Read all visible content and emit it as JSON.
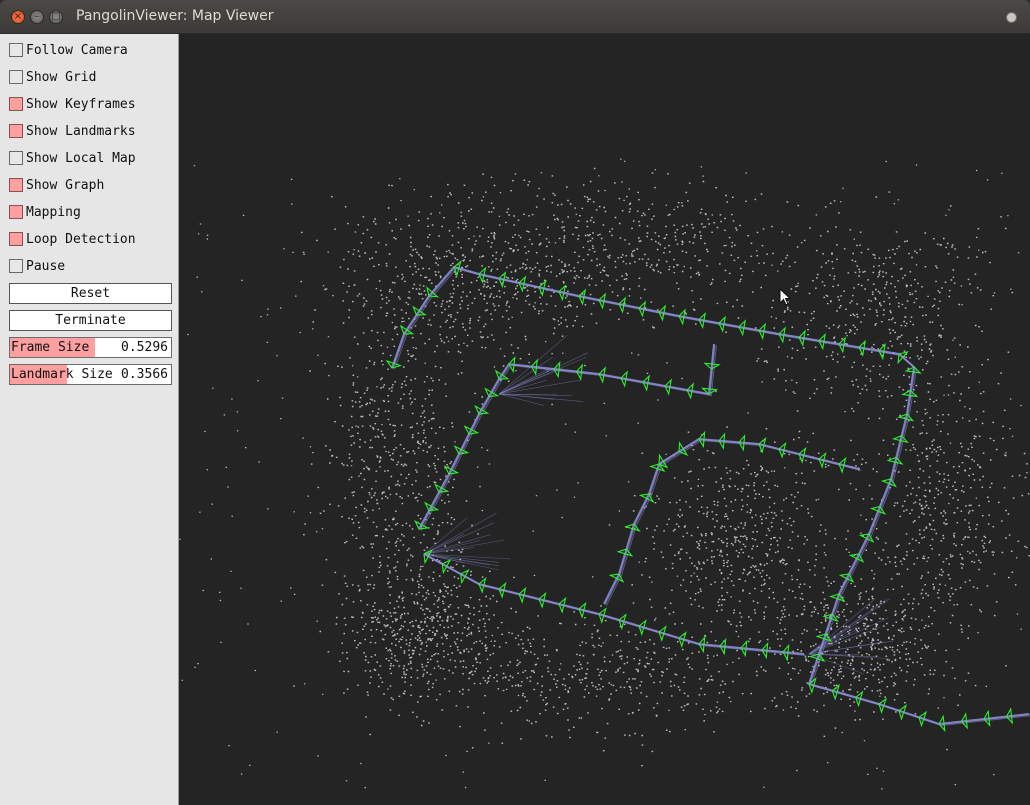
{
  "window": {
    "title": "PangolinViewer: Map Viewer",
    "buttons": {
      "close": "×",
      "minimize": "–",
      "maximize": "□"
    }
  },
  "panel": {
    "toggles": [
      {
        "label": "Follow Camera",
        "checked": false
      },
      {
        "label": "Show Grid",
        "checked": false
      },
      {
        "label": "Show Keyframes",
        "checked": true
      },
      {
        "label": "Show Landmarks",
        "checked": true
      },
      {
        "label": "Show Local Map",
        "checked": false
      },
      {
        "label": "Show Graph",
        "checked": true
      },
      {
        "label": "Mapping",
        "checked": true
      },
      {
        "label": "Loop Detection",
        "checked": true
      },
      {
        "label": "Pause",
        "checked": false
      }
    ],
    "buttons": {
      "reset": "Reset",
      "terminate": "Terminate"
    },
    "sliders": {
      "frame_size": {
        "label": "Frame Size",
        "value": "0.5296",
        "fill": 0.5296
      },
      "landmark_size": {
        "label": "Landmark Size",
        "value": "0.3566",
        "fill": 0.3566
      }
    }
  },
  "colors": {
    "checked": "#ff9f9f",
    "keyframe": "#2cf22c",
    "graph_edge": "#8c8cd8",
    "landmark": "#d8d8d8",
    "viewport_bg": "#242424"
  },
  "viewport": {
    "content": "3D map view: point cloud landmarks, green keyframe frustums along a looped trajectory, graph edges"
  }
}
